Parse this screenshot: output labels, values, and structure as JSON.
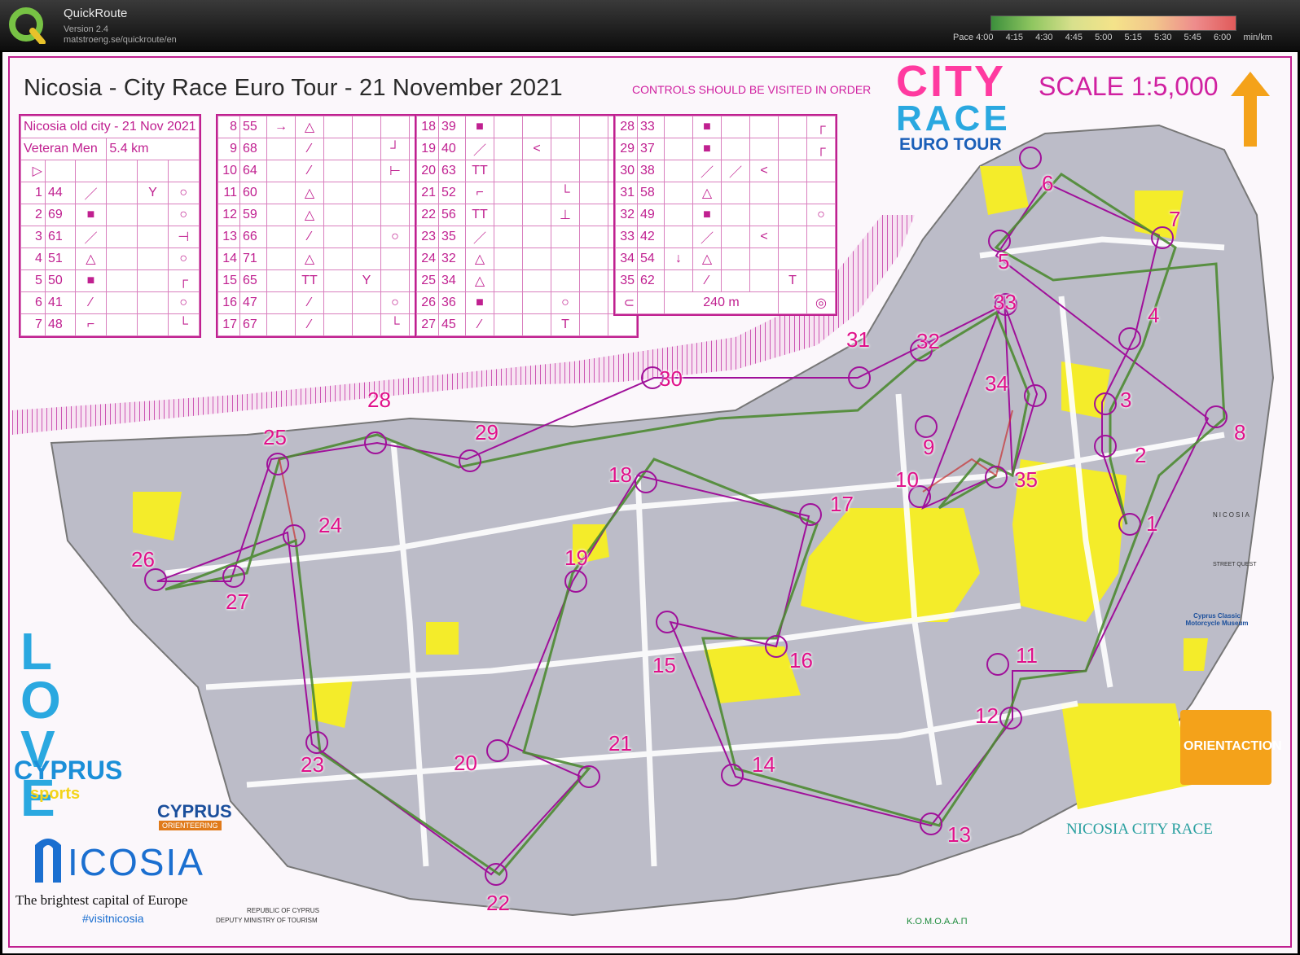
{
  "app": {
    "title": "QuickRoute",
    "version": "Version 2.4",
    "url": "matstroeng.se/quickroute/en"
  },
  "pace_scale": {
    "prefix": "Pace 4:00",
    "labels": [
      "4:15",
      "4:30",
      "4:45",
      "5:00",
      "5:15",
      "5:30",
      "5:45",
      "6:00",
      "min/km"
    ],
    "colors": [
      "#3c8f3c",
      "#8fc660",
      "#d8e08c",
      "#f4e38a",
      "#f2c68c",
      "#ee8c8c",
      "#e05a5a"
    ]
  },
  "map": {
    "title": "Nicosia - City Race Euro Tour - 21 November 2021",
    "order_note": "CONTROLS SHOULD BE VISITED IN ORDER",
    "scale": "SCALE 1:5,000",
    "logo_city": "CITY",
    "logo_race": "RACE",
    "logo_euro_tour": "EURO  TOUR"
  },
  "description_sheet": {
    "event": "Nicosia old city - 21 Nov 2021",
    "class": "Veteran Men",
    "length": "5.4 km",
    "col1": [
      {
        "n": "1",
        "code": "44"
      },
      {
        "n": "2",
        "code": "69"
      },
      {
        "n": "3",
        "code": "61"
      },
      {
        "n": "4",
        "code": "51"
      },
      {
        "n": "5",
        "code": "50"
      },
      {
        "n": "6",
        "code": "41"
      },
      {
        "n": "7",
        "code": "48"
      }
    ],
    "col2": [
      {
        "n": "8",
        "code": "55"
      },
      {
        "n": "9",
        "code": "68"
      },
      {
        "n": "10",
        "code": "64"
      },
      {
        "n": "11",
        "code": "60"
      },
      {
        "n": "12",
        "code": "59"
      },
      {
        "n": "13",
        "code": "66"
      },
      {
        "n": "14",
        "code": "71"
      },
      {
        "n": "15",
        "code": "65"
      },
      {
        "n": "16",
        "code": "47"
      },
      {
        "n": "17",
        "code": "67"
      }
    ],
    "col3": [
      {
        "n": "18",
        "code": "39"
      },
      {
        "n": "19",
        "code": "40"
      },
      {
        "n": "20",
        "code": "63"
      },
      {
        "n": "21",
        "code": "52"
      },
      {
        "n": "22",
        "code": "56"
      },
      {
        "n": "23",
        "code": "35"
      },
      {
        "n": "24",
        "code": "32"
      },
      {
        "n": "25",
        "code": "34"
      },
      {
        "n": "26",
        "code": "36"
      },
      {
        "n": "27",
        "code": "45"
      }
    ],
    "col4": [
      {
        "n": "28",
        "code": "33"
      },
      {
        "n": "29",
        "code": "37"
      },
      {
        "n": "30",
        "code": "38"
      },
      {
        "n": "31",
        "code": "58"
      },
      {
        "n": "32",
        "code": "49"
      },
      {
        "n": "33",
        "code": "42"
      },
      {
        "n": "34",
        "code": "54"
      },
      {
        "n": "35",
        "code": "62"
      }
    ],
    "finish_distance": "240 m"
  },
  "controls": [
    "1",
    "2",
    "3",
    "4",
    "5",
    "6",
    "7",
    "8",
    "9",
    "10",
    "11",
    "12",
    "13",
    "14",
    "15",
    "16",
    "17",
    "18",
    "19",
    "20",
    "21",
    "22",
    "23",
    "24",
    "25",
    "26",
    "27",
    "28",
    "29",
    "30",
    "31",
    "32",
    "33",
    "34",
    "35"
  ],
  "sponsors": {
    "love": "LOVE",
    "cyprus_sports_1": "CYPRUS",
    "cyprus_sports_2": "sports",
    "cyprus_orienteering": "CYPRUS",
    "cyprus_orienteering_sub": "ORIENTEERING",
    "nicosia": "ICOSIA",
    "nicosia_tagline": "The brightest capital of Europe",
    "nicosia_hashtag": "#visitnicosia",
    "ministry_1": "REPUBLIC OF CYPRUS",
    "ministry_2": "DEPUTY MINISTRY OF TOURISM",
    "komoaap": "Κ.Ο.Μ.Ο.Α.Α.Π",
    "nicosia_city_race": "NICOSIA CITY RACE",
    "orientaction": "ORIENTACTION",
    "street_quest_1": "NICOSIA",
    "street_quest_2": "STREET QUEST",
    "motorcycle_museum": "Cyprus Classic Motorcycle Museum"
  }
}
